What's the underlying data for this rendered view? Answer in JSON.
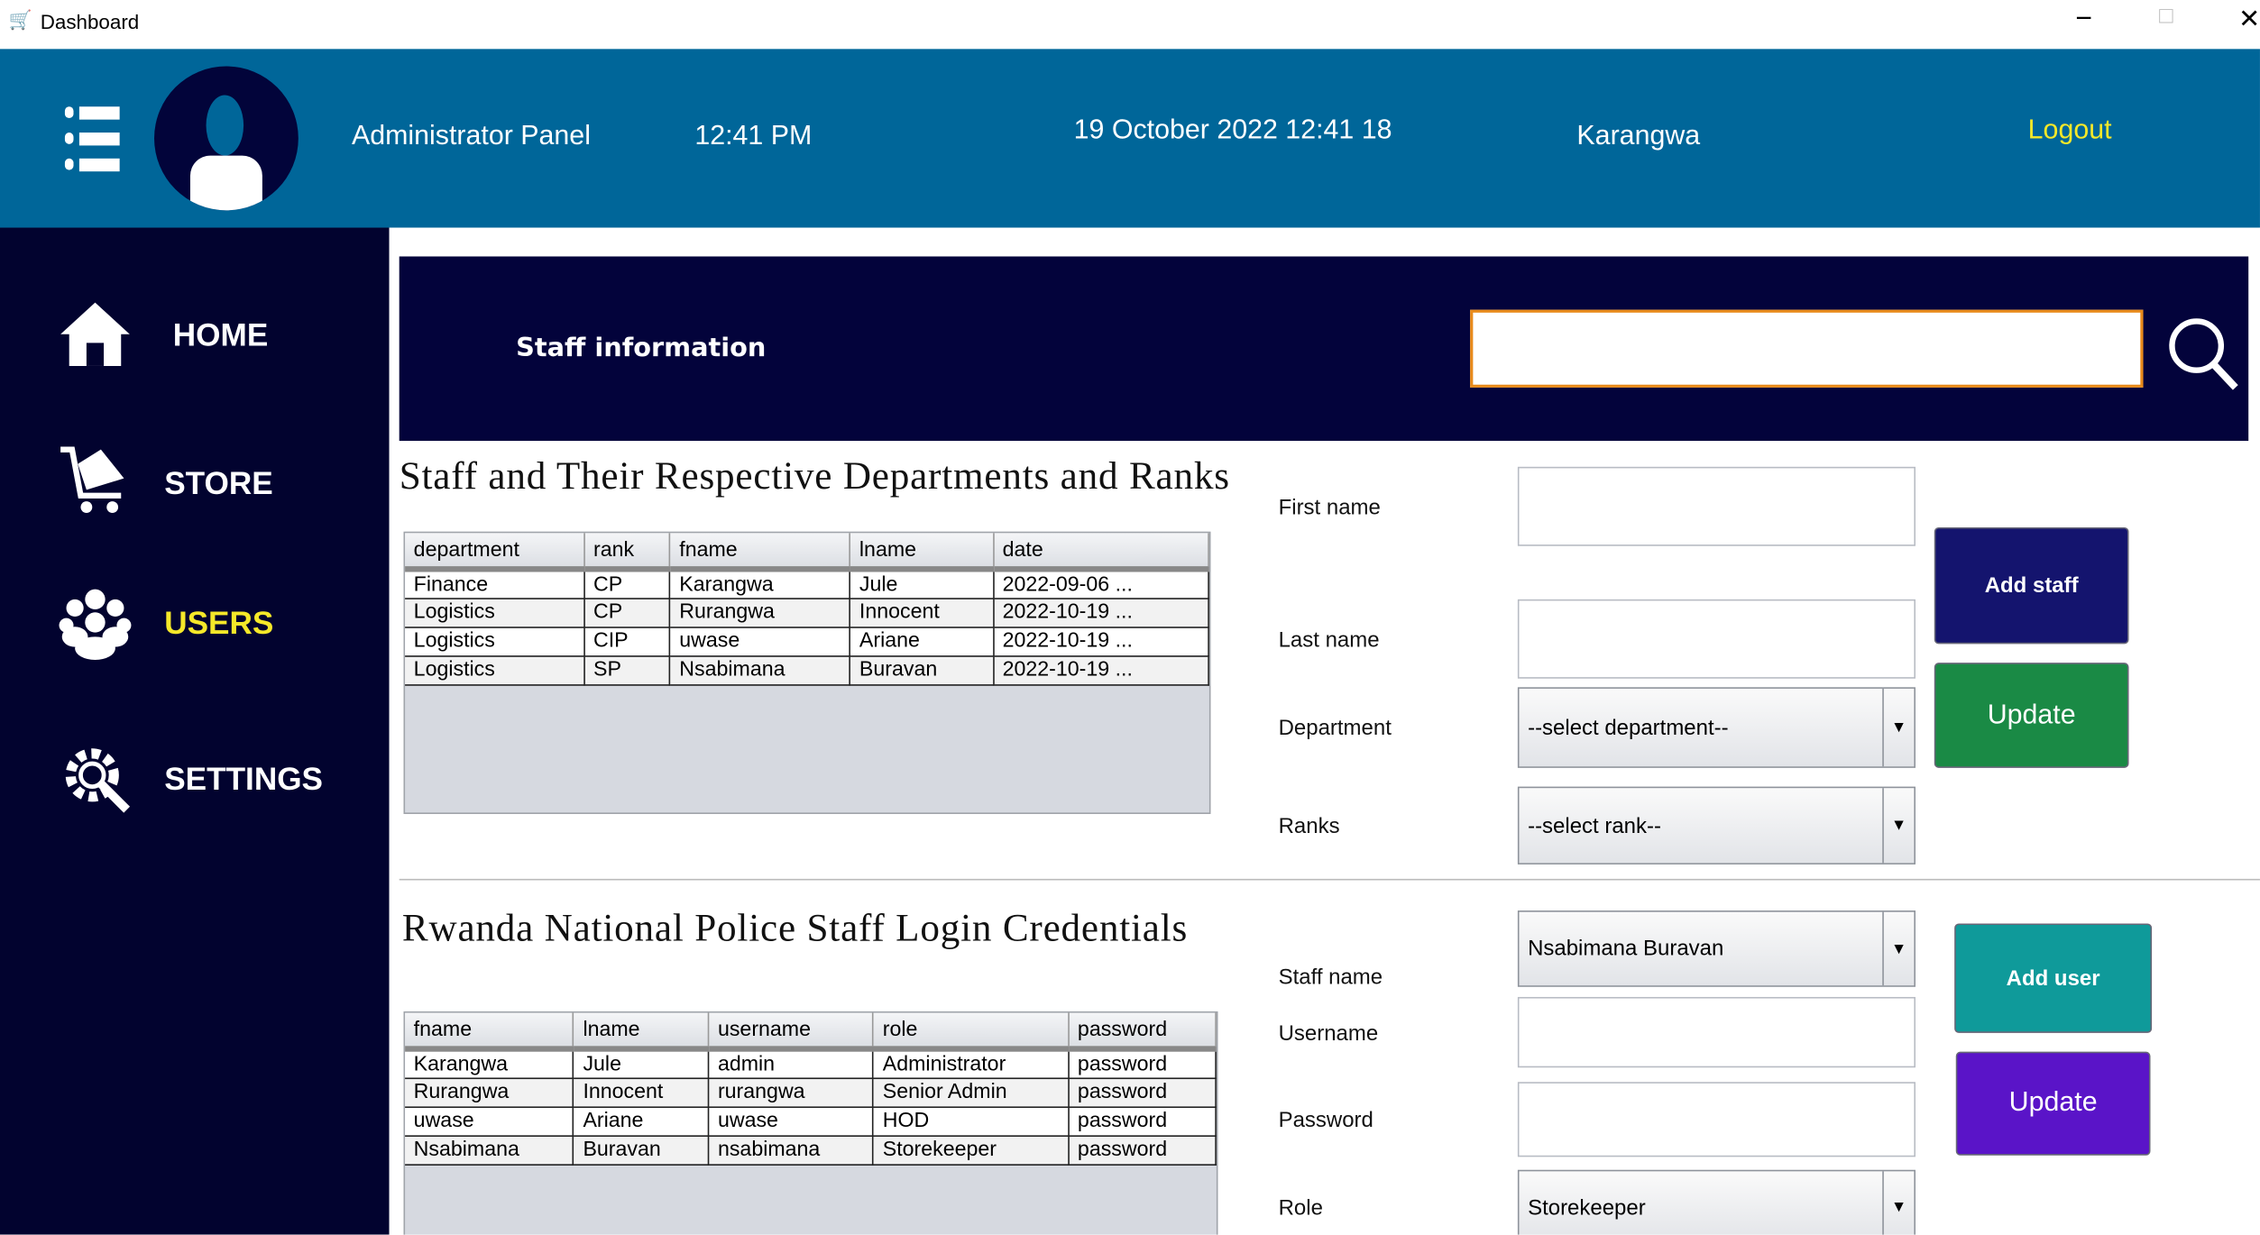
{
  "window": {
    "title": "Dashboard",
    "icon": "cart-icon"
  },
  "header": {
    "panel": "Administrator Panel",
    "time": "12:41 PM",
    "datetime": "19 October 2022 12:41 18",
    "user": "Karangwa",
    "logout": "Logout"
  },
  "sidebar": {
    "items": [
      {
        "label": "HOME",
        "icon": "home-icon"
      },
      {
        "label": "STORE",
        "icon": "cart-icon"
      },
      {
        "label": "USERS",
        "icon": "users-icon",
        "active": true
      },
      {
        "label": "SETTINGS",
        "icon": "gear-icon"
      }
    ]
  },
  "banner": {
    "title": "Staff information",
    "search_value": ""
  },
  "staff": {
    "heading": "Staff and Their Respective Departments and Ranks",
    "columns": [
      "department",
      "rank",
      "fname",
      "lname",
      "date"
    ],
    "rows": [
      [
        "Finance",
        "CP",
        "Karangwa",
        "Jule",
        "2022-09-06 ..."
      ],
      [
        "Logistics",
        "CP",
        "Rurangwa",
        "Innocent",
        "2022-10-19 ..."
      ],
      [
        "Logistics",
        "CIP",
        "uwase",
        "Ariane",
        "2022-10-19 ..."
      ],
      [
        "Logistics",
        "SP",
        "Nsabimana",
        "Buravan",
        "2022-10-19 ..."
      ]
    ],
    "form": {
      "first_name": "First name",
      "last_name": "Last name",
      "department": "Department",
      "department_value": "--select department--",
      "ranks": "Ranks",
      "rank_value": "--select rank--",
      "add": "Add staff",
      "update": "Update"
    }
  },
  "creds": {
    "heading": "Rwanda National Police Staff Login Credentials",
    "columns": [
      "fname",
      "lname",
      "username",
      "role",
      "password"
    ],
    "rows": [
      [
        "Karangwa",
        "Jule",
        "admin",
        "Administrator",
        "password"
      ],
      [
        "Rurangwa",
        "Innocent",
        "rurangwa",
        "Senior Admin",
        "password"
      ],
      [
        "uwase",
        "Ariane",
        "uwase",
        "HOD",
        "password"
      ],
      [
        "Nsabimana",
        "Buravan",
        "nsabimana",
        "Storekeeper",
        "password"
      ]
    ],
    "form": {
      "staff_name": "Staff name",
      "staff_value": "Nsabimana Buravan",
      "username": "Username",
      "password": "Password",
      "role": "Role",
      "role_value": "Storekeeper",
      "add": "Add user",
      "update": "Update"
    }
  },
  "colors": {
    "header": "#006699",
    "sidebar": "#02032f",
    "active": "#f5e829",
    "green": "#1a8a45",
    "teal": "#0f9a9a",
    "purple": "#5a14c8"
  }
}
